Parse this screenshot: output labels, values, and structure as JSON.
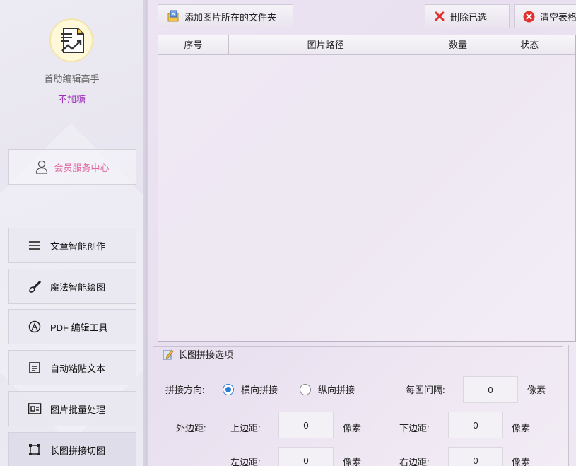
{
  "sidebar": {
    "app_name": "首助编辑高手",
    "app_sub": "不加糖",
    "member_label": "会员服务中心",
    "items": [
      {
        "label": "文章智能创作",
        "icon": "menu-lines-icon"
      },
      {
        "label": "魔法智能绘图",
        "icon": "brush-icon"
      },
      {
        "label": "PDF 编辑工具",
        "icon": "pdf-icon"
      },
      {
        "label": "自动粘贴文本",
        "icon": "paste-text-icon"
      },
      {
        "label": "图片批量处理",
        "icon": "image-batch-icon"
      },
      {
        "label": "长图拼接切图",
        "icon": "stitch-icon"
      }
    ]
  },
  "toolbar": {
    "add_folder_label": "添加图片所在的文件夹",
    "delete_selected_label": "删除已选",
    "clear_label": "清空表格"
  },
  "table": {
    "columns": [
      "序号",
      "图片路径",
      "数量",
      "状态"
    ],
    "rows": []
  },
  "options": {
    "title": "长图拼接选项",
    "direction_label": "拼接方向:",
    "horizontal_label": "横向拼接",
    "vertical_label": "纵向拼接",
    "selected_direction": "horizontal",
    "gap_label": "每图间隔:",
    "gap_value": "0",
    "pixel_unit": "像素",
    "margin_label": "外边距:",
    "top_label": "上边距:",
    "top_value": "0",
    "bottom_label": "下边距:",
    "bottom_value": "0",
    "left_label": "左边距:",
    "left_value": "0",
    "right_label": "右边距:",
    "right_value": "0"
  },
  "colors": {
    "accent_blue": "#2b7cd6",
    "member_pink": "#e06aa0",
    "sub_purple": "#9b2fb8",
    "delete_red": "#e0322e"
  }
}
